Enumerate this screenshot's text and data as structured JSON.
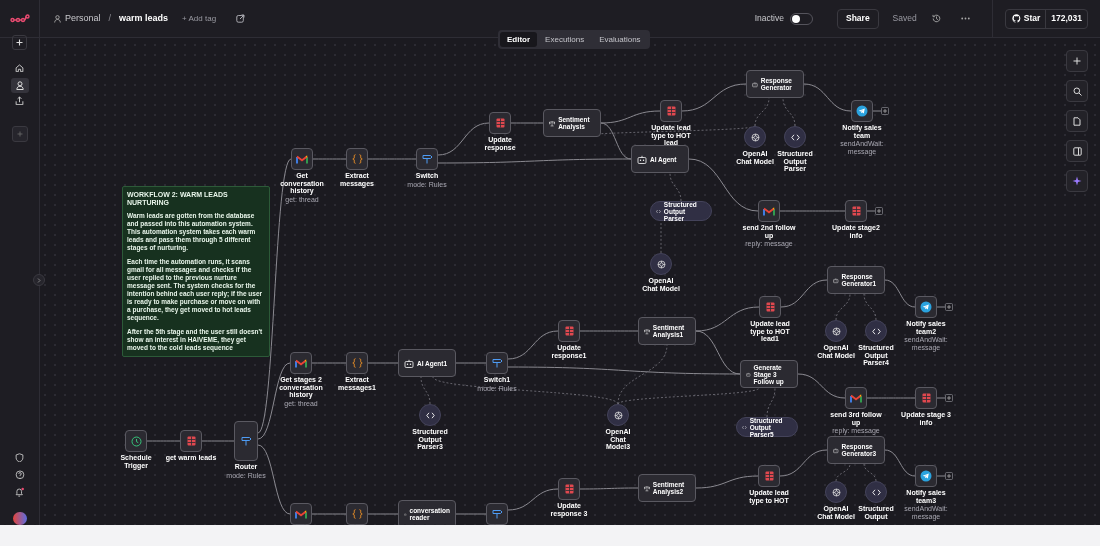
{
  "header": {
    "workspace": "Personal",
    "separator": "/",
    "workflow_name": "warm leads",
    "add_tag": "+ Add tag",
    "status": {
      "label": "Inactive",
      "on": false
    },
    "share": "Share",
    "saved": "Saved",
    "github": {
      "star": "Star",
      "count": "172,031"
    }
  },
  "tabs": [
    {
      "label": "Editor",
      "selected": true
    },
    {
      "label": "Executions",
      "selected": false
    },
    {
      "label": "Evaluations",
      "selected": false
    }
  ],
  "sticky_note": {
    "title": "WORKFLOW 2: WARM LEADS NURTURING",
    "paragraphs": [
      "Warm leads are gotten from the database and passed into this automation system. This automation system takes each warm leads and pass them through 5 different stages of nurturing.",
      "Each time the automation runs, it scans gmail for all messages and checks if the user replied to the previous nurture message sent. The system checks for the intention behind each user reply; if the user is ready to make purchase or move on with a purchase, they get moved to hot leads sequence.",
      "After the 5th stage and the user still doesn't show an interest in HAIVEME, they get moved to the cold leads sequence"
    ]
  },
  "nodes": [
    {
      "kind": "gmail",
      "label": "Get conversation history",
      "subtitle": "get: thread"
    },
    {
      "kind": "code",
      "label": "Extract messages"
    },
    {
      "kind": "switch",
      "label": "Switch",
      "subtitle": "mode: Rules"
    },
    {
      "kind": "sheets",
      "label": "Update response"
    },
    {
      "kind": "sentiment",
      "label": "Sentiment Analysis"
    },
    {
      "kind": "sheets",
      "label": "Update lead type to HOT lead"
    },
    {
      "kind": "agent",
      "label": "Response Generator"
    },
    {
      "kind": "model",
      "label": "OpenAI Chat Model"
    },
    {
      "kind": "parser",
      "label": "Structured Output Parser"
    },
    {
      "kind": "telegram",
      "label": "Notify sales team",
      "subtitle": "sendAndWait: message"
    },
    {
      "kind": "agent",
      "label": "AI Agent"
    },
    {
      "kind": "parser_pill",
      "label": "Structured Output Parser"
    },
    {
      "kind": "model",
      "label": "OpenAI Chat Model"
    },
    {
      "kind": "gmail",
      "label": "send 2nd follow up",
      "subtitle": "reply: message"
    },
    {
      "kind": "sheets",
      "label": "Update stage2 info"
    },
    {
      "kind": "agent",
      "label": "Response Generator1"
    },
    {
      "kind": "gmail",
      "label": "Get stages 2 conversation history",
      "subtitle": "get: thread"
    },
    {
      "kind": "code",
      "label": "Extract messages1"
    },
    {
      "kind": "agent",
      "label": "AI Agent1"
    },
    {
      "kind": "switch",
      "label": "Switch1",
      "subtitle": "mode: Rules"
    },
    {
      "kind": "sheets",
      "label": "Update response1"
    },
    {
      "kind": "sentiment",
      "label": "Sentiment Analysis1"
    },
    {
      "kind": "sheets",
      "label": "Update lead type to HOT lead1"
    },
    {
      "kind": "model",
      "label": "OpenAI Chat Model"
    },
    {
      "kind": "parser",
      "label": "Structured Output Parser4"
    },
    {
      "kind": "telegram",
      "label": "Notify sales team2",
      "subtitle": "sendAndWait: message"
    },
    {
      "kind": "agent",
      "label": "Generate Stage 3 Follow up"
    },
    {
      "kind": "parser",
      "label": "Structured Output Parser3"
    },
    {
      "kind": "model",
      "label": "OpenAI Chat Model3"
    },
    {
      "kind": "parser_pill",
      "label": "Structured Output Parser5"
    },
    {
      "kind": "gmail",
      "label": "send 3rd follow up",
      "subtitle": "reply: message"
    },
    {
      "kind": "sheets",
      "label": "Update stage 3 info"
    },
    {
      "kind": "trigger",
      "label": "Schedule Trigger"
    },
    {
      "kind": "sheets",
      "label": "get warm leads"
    },
    {
      "kind": "router",
      "label": "Router",
      "subtitle": "mode: Rules"
    },
    {
      "kind": "gmail"
    },
    {
      "kind": "code"
    },
    {
      "kind": "agent",
      "label": "conversation reader"
    },
    {
      "kind": "switch"
    },
    {
      "kind": "sheets",
      "label": "Update response 3"
    },
    {
      "kind": "sentiment",
      "label": "Sentiment Analysis2"
    },
    {
      "kind": "sheets",
      "label": "Update lead type to HOT"
    },
    {
      "kind": "agent",
      "label": "Response Generator3"
    },
    {
      "kind": "model",
      "label": "OpenAI Chat Model"
    },
    {
      "kind": "parser",
      "label": "Structured Output"
    },
    {
      "kind": "telegram",
      "label": "Notify sales team3",
      "subtitle": "sendAndWait: message"
    }
  ]
}
